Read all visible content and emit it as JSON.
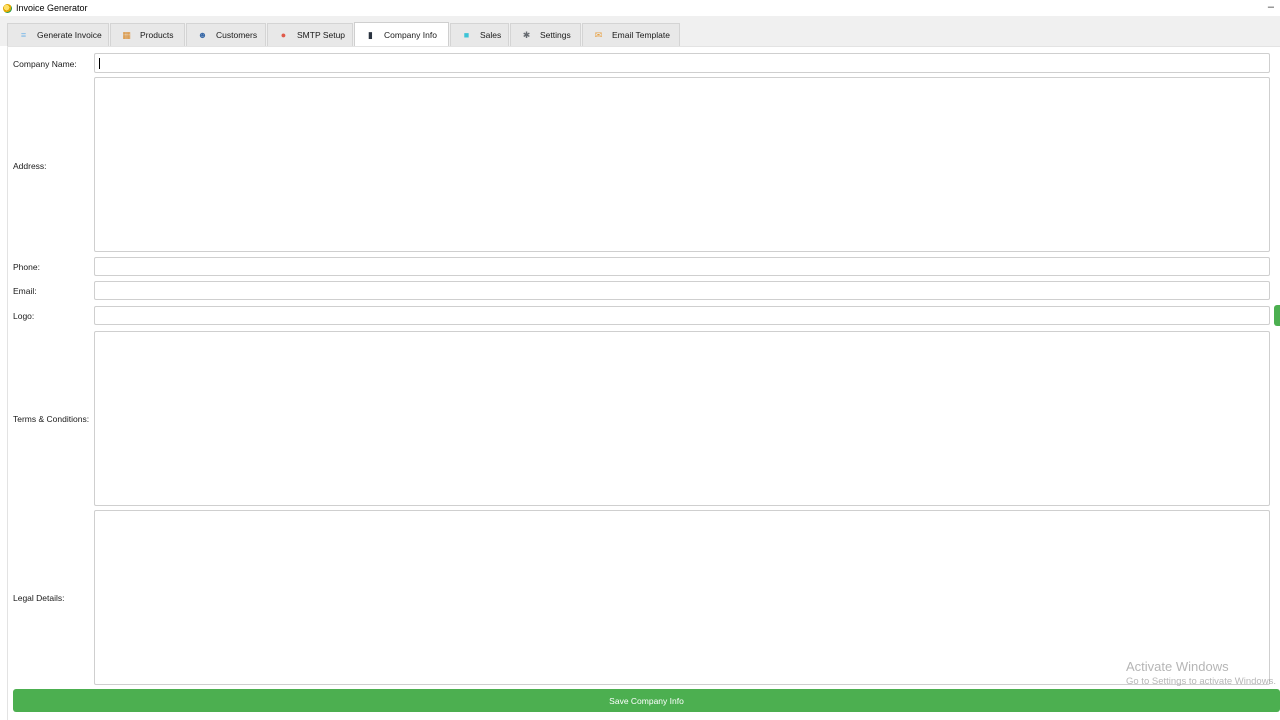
{
  "window": {
    "title": "Invoice Generator",
    "minimize_glyph": "–"
  },
  "tabs": [
    {
      "label": "Generate Invoice",
      "icon": "document-lines-icon",
      "glyph": "≡",
      "color": "#7ab8e8"
    },
    {
      "label": "Products",
      "icon": "boxes-icon",
      "glyph": "▦",
      "color": "#d98a2b"
    },
    {
      "label": "Customers",
      "icon": "person-icon",
      "glyph": "☻",
      "color": "#3a6aa8"
    },
    {
      "label": "SMTP Setup",
      "icon": "mail-server-icon",
      "glyph": "●",
      "color": "#e05a4a"
    },
    {
      "label": "Company Info",
      "icon": "notebook-icon",
      "glyph": "▮",
      "color": "#2a3340",
      "active": true
    },
    {
      "label": "Sales",
      "icon": "chart-icon",
      "glyph": "■",
      "color": "#3cc3d6"
    },
    {
      "label": "Settings",
      "icon": "gear-icon",
      "glyph": "✱",
      "color": "#666a70"
    },
    {
      "label": "Email Template",
      "icon": "envelope-icon",
      "glyph": "✉",
      "color": "#e8a040"
    }
  ],
  "form": {
    "company_name_label": "Company Name:",
    "company_name_value": "",
    "address_label": "Address:",
    "phone_label": "Phone:",
    "email_label": "Email:",
    "logo_label": "Logo:",
    "terms_label": "Terms & Conditions:",
    "legal_label": "Legal Details:"
  },
  "save_button": {
    "label": "Save Company Info",
    "color": "#4caf50"
  },
  "watermark": {
    "line1": "Activate Windows",
    "line2": "Go to Settings to activate Windows."
  }
}
